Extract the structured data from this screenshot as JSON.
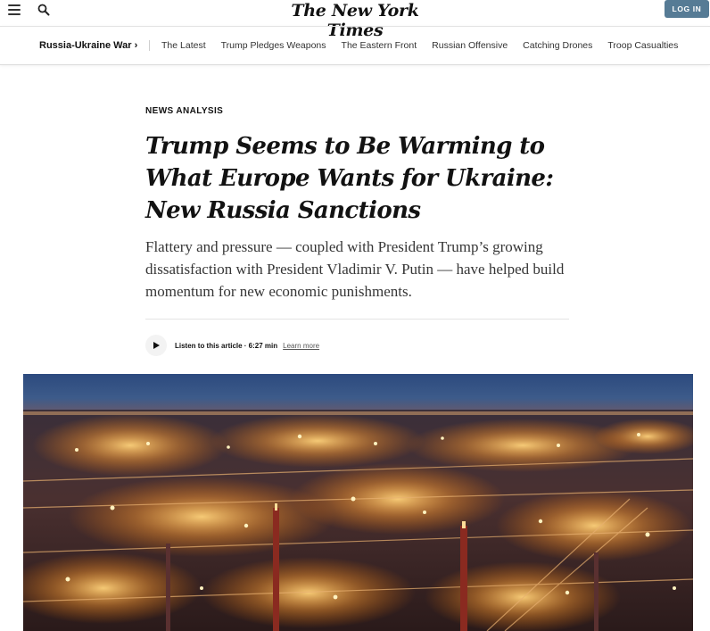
{
  "header": {
    "logo": "The New York Times",
    "login_label": "LOG IN",
    "icons": [
      "menu-icon",
      "search-icon"
    ]
  },
  "nav": {
    "section": "Russia-Ukraine War ›",
    "items": [
      "The Latest",
      "Trump Pledges Weapons",
      "The Eastern Front",
      "Russian Offensive",
      "Catching Drones",
      "Troop Casualties"
    ]
  },
  "article": {
    "kicker": "NEWS ANALYSIS",
    "headline": "Trump Seems to Be Warming to What Europe Wants for Ukraine: New Russia Sanctions",
    "summary": "Flattery and pressure — coupled with President Trump’s growing dissatisfaction with President Vladimir V. Putin — have helped build momentum for new economic punishments.",
    "listen": {
      "label": "Listen to this article · 6:27 min",
      "learn_more": "Learn more"
    }
  },
  "hero_image": {
    "subject": "industrial-plant-at-night-photo"
  },
  "colors": {
    "login_bg": "#567b95",
    "text": "#121212",
    "summary_text": "#363636"
  }
}
